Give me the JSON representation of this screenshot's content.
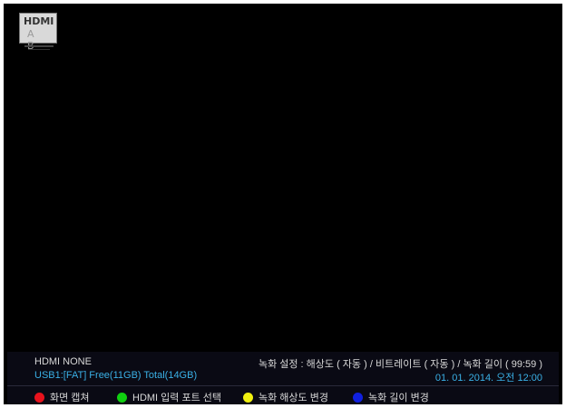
{
  "badge": {
    "logo": "HDMI",
    "ports": "A B"
  },
  "info": {
    "hdmi_status": "HDMI NONE",
    "usb_status": "USB1:[FAT] Free(11GB) Total(14GB)",
    "record_settings": "녹화 설정 : 해상도 ( 자동 ) / 비트레이트 ( 자동 ) / 녹화 길이 ( 99:59 )",
    "datetime": "01. 01. 2014. 오전 12:00"
  },
  "buttons": [
    {
      "label": "화면 캡쳐",
      "color": "#e8121c",
      "icon": "red-circle-icon"
    },
    {
      "label": "HDMI 입력 포트 선택",
      "color": "#10d010",
      "icon": "green-circle-icon"
    },
    {
      "label": "녹화 해상도 변경",
      "color": "#f0f010",
      "icon": "yellow-circle-icon"
    },
    {
      "label": "녹화 길이 변경",
      "color": "#1020e0",
      "icon": "blue-circle-icon"
    }
  ]
}
